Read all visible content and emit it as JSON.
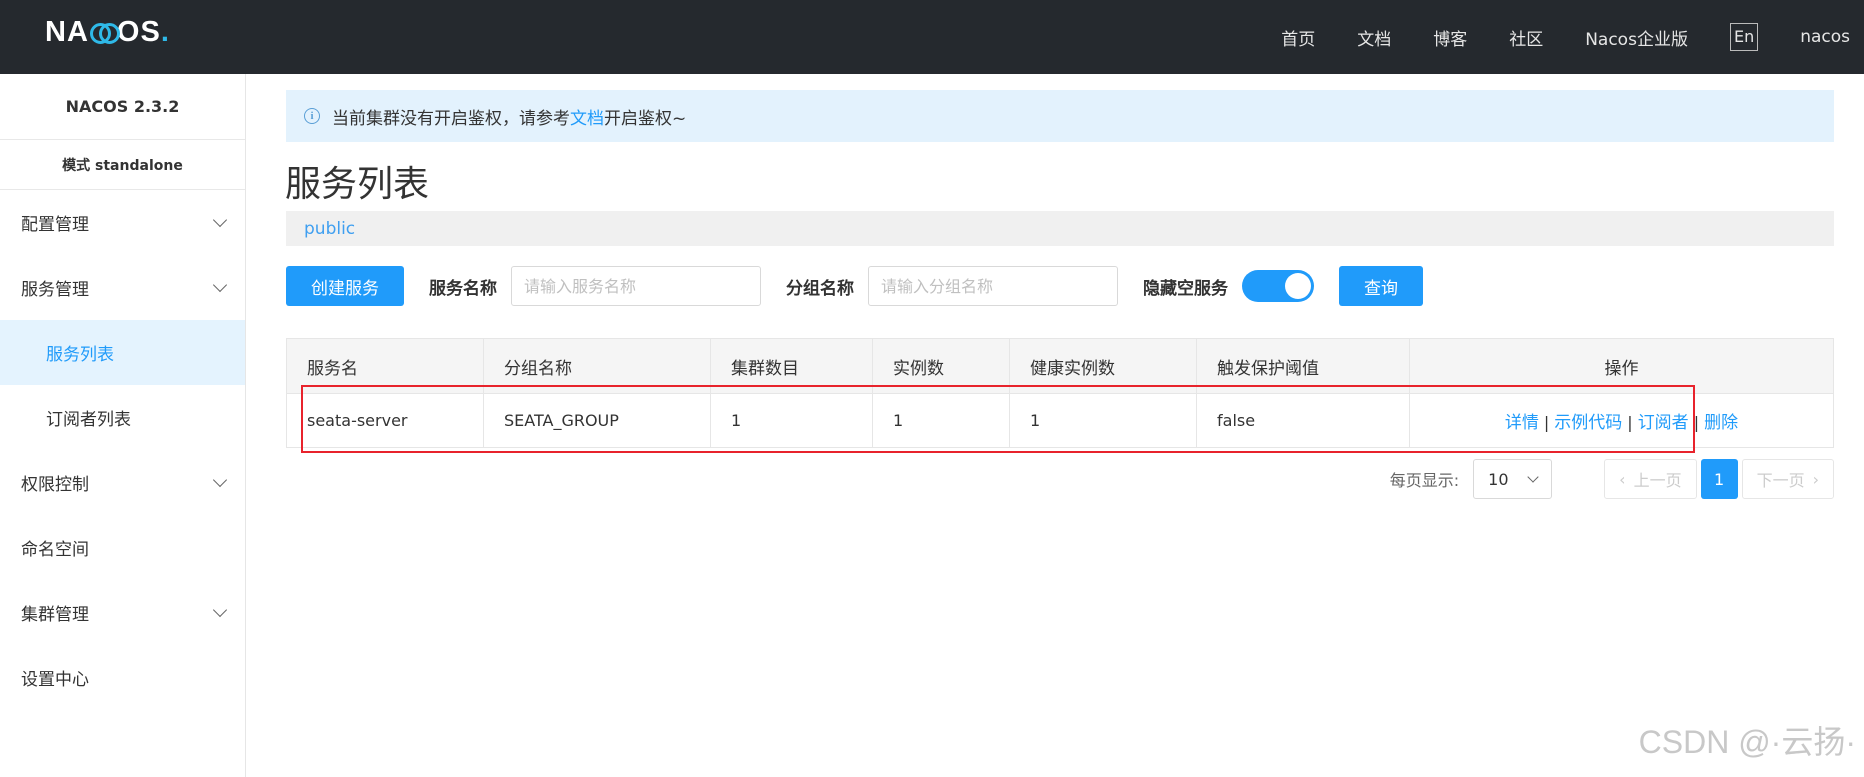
{
  "header": {
    "logo": "NACOS.",
    "nav": [
      "首页",
      "文档",
      "博客",
      "社区",
      "Nacos企业版"
    ],
    "lang": "En",
    "user": "nacos"
  },
  "sidebar": {
    "version": "NACOS 2.3.2",
    "mode": "模式 standalone",
    "items": [
      {
        "label": "配置管理"
      },
      {
        "label": "服务管理"
      },
      {
        "label": "服务列表"
      },
      {
        "label": "订阅者列表"
      },
      {
        "label": "权限控制"
      },
      {
        "label": "命名空间"
      },
      {
        "label": "集群管理"
      },
      {
        "label": "设置中心"
      }
    ]
  },
  "notice": {
    "before": "当前集群没有开启鉴权，请参考",
    "link": "文档",
    "after": "开启鉴权~"
  },
  "page_title": "服务列表",
  "namespace": "public",
  "toolbar": {
    "create_label": "创建服务",
    "service_name_label": "服务名称",
    "service_name_placeholder": "请输入服务名称",
    "group_name_label": "分组名称",
    "group_name_placeholder": "请输入分组名称",
    "hide_empty_label": "隐藏空服务",
    "hide_empty_on": true,
    "query_label": "查询"
  },
  "table": {
    "headers": [
      "服务名",
      "分组名称",
      "集群数目",
      "实例数",
      "健康实例数",
      "触发保护阈值",
      "操作"
    ],
    "rows": [
      {
        "service": "seata-server",
        "group": "SEATA_GROUP",
        "clusters": "1",
        "instances": "1",
        "healthy": "1",
        "threshold": "false",
        "actions": [
          "详情",
          "示例代码",
          "订阅者",
          "删除"
        ]
      }
    ]
  },
  "pagination": {
    "page_size_label": "每页显示:",
    "page_size": "10",
    "prev_label": "上一页",
    "current": "1",
    "next_label": "下一页"
  },
  "watermark": "CSDN @·云扬·",
  "colors": {
    "primary": "#209bfa",
    "topbar": "#25292e",
    "highlight": "#e8232c"
  }
}
